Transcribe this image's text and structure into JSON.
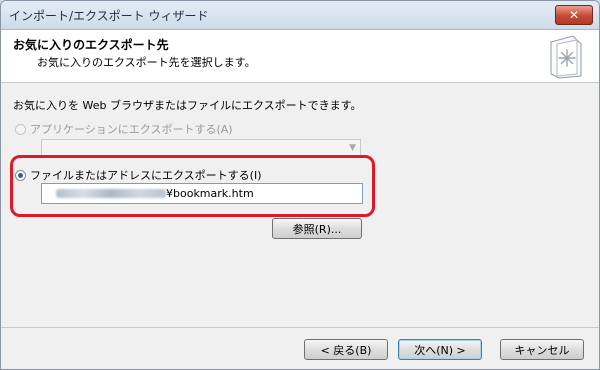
{
  "window": {
    "title": "インポート/エクスポート ウィザード",
    "close_label": "✕"
  },
  "header": {
    "title": "お気に入りのエクスポート先",
    "subtitle": "お気に入りのエクスポート先を選択します。",
    "icon": "wizard-document-icon"
  },
  "body": {
    "description": "お気に入りを Web ブラウザまたはファイルにエクスポートできます。",
    "option_app": {
      "label": "アプリケーションにエクスポートする(A)",
      "selected": false,
      "enabled": false
    },
    "app_select": {
      "value": ""
    },
    "option_file": {
      "label": "ファイルまたはアドレスにエクスポートする(I)",
      "selected": true,
      "enabled": true
    },
    "file_path": {
      "suffix": "¥bookmark.htm"
    },
    "browse_label": "参照(R)..."
  },
  "footer": {
    "back_label": "< 戻る(B)",
    "next_label": "次へ(N) >",
    "cancel_label": "キャンセル"
  },
  "colors": {
    "highlight": "#e0192a",
    "accent": "#2c5f9e"
  }
}
